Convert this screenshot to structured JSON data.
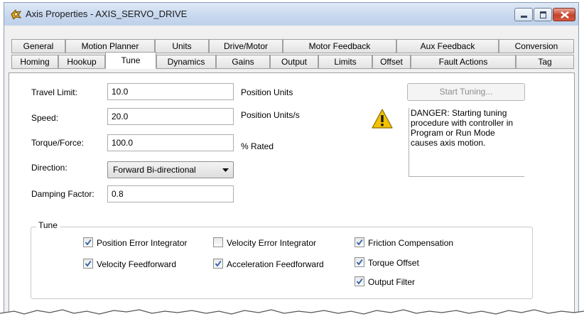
{
  "window": {
    "title": "Axis Properties - AXIS_SERVO_DRIVE",
    "icon": "axis-properties-icon"
  },
  "tabs_row1": [
    "General",
    "Motion Planner",
    "Units",
    "Drive/Motor",
    "Motor Feedback",
    "Aux Feedback",
    "Conversion"
  ],
  "tabs_row2": [
    "Homing",
    "Hookup",
    "Tune",
    "Dynamics",
    "Gains",
    "Output",
    "Limits",
    "Offset",
    "Fault Actions",
    "Tag"
  ],
  "active_tab": "Tune",
  "form": {
    "travel_limit": {
      "label": "Travel Limit:",
      "value": "10.0",
      "unit": "Position Units"
    },
    "speed": {
      "label": "Speed:",
      "value": "20.0",
      "unit": "Position Units/s"
    },
    "torque": {
      "label": "Torque/Force:",
      "value": "100.0",
      "unit": "% Rated"
    },
    "direction": {
      "label": "Direction:",
      "value": "Forward Bi-directional"
    },
    "damping": {
      "label": "Damping Factor:",
      "value": "0.8"
    }
  },
  "start_tuning": {
    "label": "Start Tuning...",
    "enabled": false
  },
  "danger_text": "DANGER: Starting tuning procedure with controller in Program or Run Mode causes axis motion.",
  "tune_group": {
    "title": "Tune",
    "checkboxes": [
      {
        "label": "Position Error Integrator",
        "checked": true
      },
      {
        "label": "Velocity Error Integrator",
        "checked": false
      },
      {
        "label": "Friction Compensation",
        "checked": true
      },
      {
        "label": "Velocity Feedforward",
        "checked": true
      },
      {
        "label": "Acceleration Feedforward",
        "checked": true
      },
      {
        "label": "Torque Offset",
        "checked": true
      },
      {
        "label": "Output Filter",
        "checked": true
      }
    ]
  },
  "colors": {
    "check": "#2b5fab",
    "warning": "#f2c200",
    "title_bar": "#c6d7ee"
  }
}
